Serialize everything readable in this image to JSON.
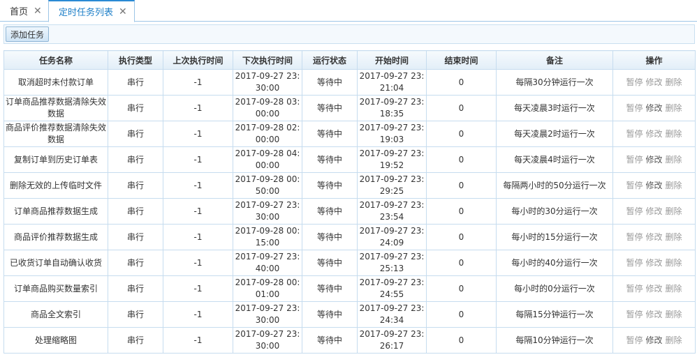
{
  "tabs": [
    {
      "label": "首页",
      "close": "✕"
    },
    {
      "label": "定时任务列表",
      "close": "✕"
    }
  ],
  "toolbar": {
    "add_label": "添加任务"
  },
  "table": {
    "headers": [
      "任务名称",
      "执行类型",
      "上次执行时间",
      "下次执行时间",
      "运行状态",
      "开始时间",
      "结束时间",
      "备注",
      "操作"
    ],
    "rows": [
      {
        "name": "取消超时未付款订单",
        "type": "串行",
        "last": "-1",
        "next": "2017-09-27 23:30:00",
        "status": "等待中",
        "start": "2017-09-27 23:21:04",
        "end": "0",
        "note": "每隔30分钟运行一次",
        "ops": [
          "暂停",
          "修改",
          "删除"
        ],
        "edit_enabled": false
      },
      {
        "name": "订单商品推荐数据清除失效数据",
        "type": "串行",
        "last": "-1",
        "next": "2017-09-28 03:00:00",
        "status": "等待中",
        "start": "2017-09-27 23:18:35",
        "end": "0",
        "note": "每天凌晨3时运行一次",
        "ops": [
          "暂停",
          "修改",
          "删除"
        ],
        "edit_enabled": true
      },
      {
        "name": "商品评价推荐数据清除失效数据",
        "type": "串行",
        "last": "-1",
        "next": "2017-09-28 02:00:00",
        "status": "等待中",
        "start": "2017-09-27 23:19:03",
        "end": "0",
        "note": "每天凌晨2时运行一次",
        "ops": [
          "暂停",
          "修改",
          "删除"
        ],
        "edit_enabled": false
      },
      {
        "name": "复制订单到历史订单表",
        "type": "串行",
        "last": "-1",
        "next": "2017-09-28 04:00:00",
        "status": "等待中",
        "start": "2017-09-27 23:19:52",
        "end": "0",
        "note": "每天凌晨4时运行一次",
        "ops": [
          "暂停",
          "修改",
          "删除"
        ],
        "edit_enabled": true
      },
      {
        "name": "删除无效的上传临时文件",
        "type": "串行",
        "last": "-1",
        "next": "2017-09-28 00:50:00",
        "status": "等待中",
        "start": "2017-09-27 23:29:25",
        "end": "0",
        "note": "每隔两小时的50分运行一次",
        "ops": [
          "暂停",
          "修改",
          "删除"
        ],
        "edit_enabled": true
      },
      {
        "name": "订单商品推荐数据生成",
        "type": "串行",
        "last": "-1",
        "next": "2017-09-27 23:30:00",
        "status": "等待中",
        "start": "2017-09-27 23:23:54",
        "end": "0",
        "note": "每小时的30分运行一次",
        "ops": [
          "暂停",
          "修改",
          "删除"
        ],
        "edit_enabled": false
      },
      {
        "name": "商品评价推荐数据生成",
        "type": "串行",
        "last": "-1",
        "next": "2017-09-28 00:15:00",
        "status": "等待中",
        "start": "2017-09-27 23:24:09",
        "end": "0",
        "note": "每小时的15分运行一次",
        "ops": [
          "暂停",
          "修改",
          "删除"
        ],
        "edit_enabled": false
      },
      {
        "name": "已收货订单自动确认收货",
        "type": "串行",
        "last": "-1",
        "next": "2017-09-27 23:40:00",
        "status": "等待中",
        "start": "2017-09-27 23:25:13",
        "end": "0",
        "note": "每小时的40分运行一次",
        "ops": [
          "暂停",
          "修改",
          "删除"
        ],
        "edit_enabled": false
      },
      {
        "name": "订单商品购买数量索引",
        "type": "串行",
        "last": "-1",
        "next": "2017-09-28 00:01:00",
        "status": "等待中",
        "start": "2017-09-27 23:24:55",
        "end": "0",
        "note": "每小时的0分运行一次",
        "ops": [
          "暂停",
          "修改",
          "删除"
        ],
        "edit_enabled": false
      },
      {
        "name": "商品全文索引",
        "type": "串行",
        "last": "-1",
        "next": "2017-09-27 23:30:00",
        "status": "等待中",
        "start": "2017-09-27 23:24:34",
        "end": "0",
        "note": "每隔15分钟运行一次",
        "ops": [
          "暂停",
          "修改",
          "删除"
        ],
        "edit_enabled": false
      },
      {
        "name": "处理缩略图",
        "type": "串行",
        "last": "-1",
        "next": "2017-09-27 23:30:00",
        "status": "等待中",
        "start": "2017-09-27 23:26:17",
        "end": "0",
        "note": "每隔10分钟运行一次",
        "ops": [
          "暂停",
          "修改",
          "删除"
        ],
        "edit_enabled": true
      }
    ]
  }
}
